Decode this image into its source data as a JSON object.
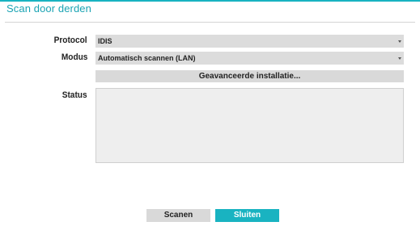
{
  "dialog": {
    "title": "Scan door derden"
  },
  "protocol": {
    "label": "Protocol",
    "value": "IDIS"
  },
  "mode": {
    "label": "Modus",
    "value": "Automatisch scannen (LAN)"
  },
  "advanced": {
    "label": "Geavanceerde installatie..."
  },
  "status": {
    "label": "Status",
    "content": ""
  },
  "footer": {
    "scan_label": "Scanen",
    "close_label": "Sluiten"
  },
  "colors": {
    "accent": "#19b3c1",
    "title": "#19a3b3"
  },
  "icons": {
    "dropdown": "chevron-down-icon"
  }
}
